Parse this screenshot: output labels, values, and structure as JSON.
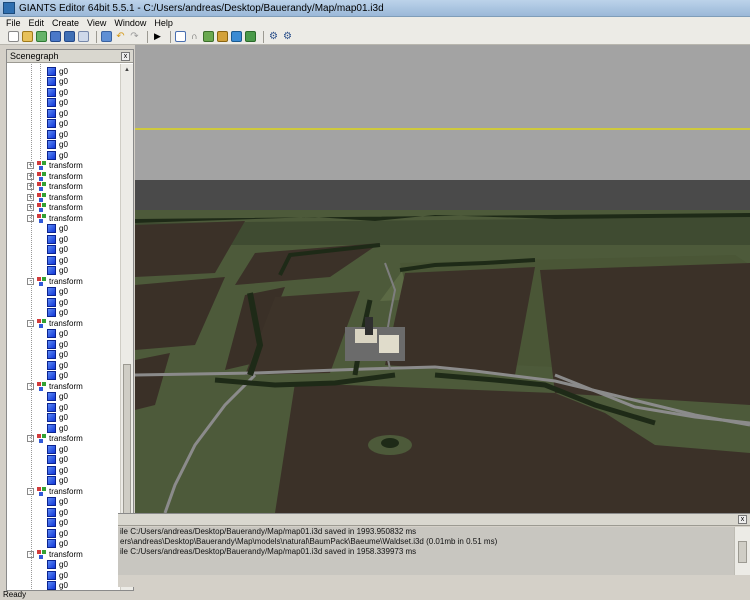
{
  "window": {
    "title": "GIANTS Editor 64bit 5.5.1 - C:/Users/andreas/Desktop/Bauerandy/Map/map01.i3d"
  },
  "menu": [
    "File",
    "Edit",
    "Create",
    "View",
    "Window",
    "Help"
  ],
  "toolbar": {
    "icons": [
      "new-file-icon",
      "open-icon",
      "refresh-icon",
      "save-icon",
      "save-all-icon",
      "export-icon",
      "import-icon",
      "undo-icon",
      "redo-icon",
      "play-icon",
      "select-icon",
      "magnet-icon",
      "terrain-paint-icon",
      "foliage-paint-icon",
      "sculpt-icon",
      "texture-paint-icon",
      "settings-gear-icon",
      "camera-gear-icon"
    ]
  },
  "scenegraph": {
    "title": "Scenegraph",
    "close_label": "x",
    "nodes": [
      {
        "label": "g0",
        "type": "shape"
      },
      {
        "label": "g0",
        "type": "shape"
      },
      {
        "label": "g0",
        "type": "shape"
      },
      {
        "label": "g0",
        "type": "shape"
      },
      {
        "label": "g0",
        "type": "shape"
      },
      {
        "label": "g0",
        "type": "shape"
      },
      {
        "label": "g0",
        "type": "shape"
      },
      {
        "label": "g0",
        "type": "shape"
      },
      {
        "label": "g0",
        "type": "shape"
      },
      {
        "label": "transform",
        "type": "transform",
        "expander": "+"
      },
      {
        "label": "transform",
        "type": "transform",
        "expander": "+"
      },
      {
        "label": "transform",
        "type": "transform",
        "expander": "+"
      },
      {
        "label": "transform",
        "type": "transform",
        "expander": "+"
      },
      {
        "label": "transform",
        "type": "transform",
        "expander": "+"
      },
      {
        "label": "transform",
        "type": "transform",
        "expander": "-"
      },
      {
        "label": "g0",
        "type": "shape"
      },
      {
        "label": "g0",
        "type": "shape"
      },
      {
        "label": "g0",
        "type": "shape"
      },
      {
        "label": "g0",
        "type": "shape"
      },
      {
        "label": "g0",
        "type": "shape"
      },
      {
        "label": "transform",
        "type": "transform",
        "expander": "-"
      },
      {
        "label": "g0",
        "type": "shape"
      },
      {
        "label": "g0",
        "type": "shape"
      },
      {
        "label": "g0",
        "type": "shape"
      },
      {
        "label": "transform",
        "type": "transform",
        "expander": "-"
      },
      {
        "label": "g0",
        "type": "shape"
      },
      {
        "label": "g0",
        "type": "shape"
      },
      {
        "label": "g0",
        "type": "shape"
      },
      {
        "label": "g0",
        "type": "shape"
      },
      {
        "label": "g0",
        "type": "shape"
      },
      {
        "label": "transform",
        "type": "transform",
        "expander": "-"
      },
      {
        "label": "g0",
        "type": "shape"
      },
      {
        "label": "g0",
        "type": "shape"
      },
      {
        "label": "g0",
        "type": "shape"
      },
      {
        "label": "g0",
        "type": "shape"
      },
      {
        "label": "transform",
        "type": "transform",
        "expander": "-"
      },
      {
        "label": "g0",
        "type": "shape"
      },
      {
        "label": "g0",
        "type": "shape"
      },
      {
        "label": "g0",
        "type": "shape"
      },
      {
        "label": "g0",
        "type": "shape"
      },
      {
        "label": "transform",
        "type": "transform",
        "expander": "-"
      },
      {
        "label": "g0",
        "type": "shape"
      },
      {
        "label": "g0",
        "type": "shape"
      },
      {
        "label": "g0",
        "type": "shape"
      },
      {
        "label": "g0",
        "type": "shape"
      },
      {
        "label": "g0",
        "type": "shape"
      },
      {
        "label": "transform",
        "type": "transform",
        "expander": "-"
      },
      {
        "label": "g0",
        "type": "shape"
      },
      {
        "label": "g0",
        "type": "shape"
      },
      {
        "label": "g0",
        "type": "shape"
      }
    ]
  },
  "console": {
    "lines": [
      "ile C:/Users/andreas/Desktop/Bauerandy/Map/map01.i3d saved in 1993.950832 ms",
      "ers\\andreas\\Desktop\\Bauerandy\\Map\\models\\natural\\BaumPack\\Baeume\\Waldset.i3d (0.01mb in 0.51 ms)",
      "ile C:/Users/andreas/Desktop/Bauerandy/Map/map01.i3d saved in 1958.339973 ms"
    ],
    "corner_label": "x"
  },
  "status": {
    "text": "Ready"
  },
  "colors": {
    "sky": "#a3a3a3",
    "horizon_line": "#e8e000",
    "grass": "#4d5a3a",
    "plowed_field": "#3b3128",
    "road": "#8b8b8b",
    "tree": "#1e2a17"
  }
}
